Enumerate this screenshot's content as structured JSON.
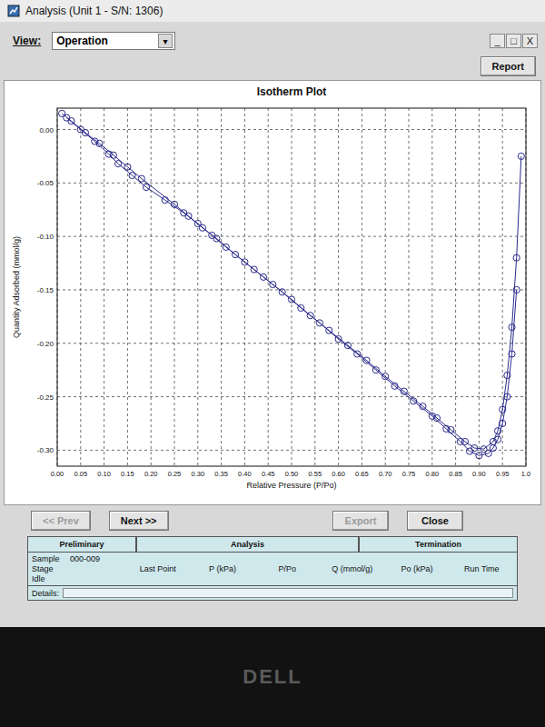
{
  "window": {
    "title": "Analysis (Unit 1 - S/N: 1306)",
    "controls": [
      "_",
      "□",
      "X"
    ]
  },
  "view": {
    "label": "View:",
    "value": "Operation",
    "arrow": "▾"
  },
  "report_button": "Report",
  "chart": {
    "title": "Isotherm Plot",
    "y_axis": {
      "label": "Quantity Adsorbed (mmol/g)",
      "ticks": [
        "0.00",
        "-0.05",
        "-0.10",
        "-0.15",
        "-0.20",
        "-0.25",
        "-0.30"
      ]
    },
    "x_axis": {
      "label": "Relative Pressure (P/Po)",
      "ticks": [
        "0.00",
        "0.05",
        "0.10",
        "0.15",
        "0.20",
        "0.25",
        "0.30",
        "0.35",
        "0.40",
        "0.45",
        "0.50",
        "0.55",
        "0.60",
        "0.65",
        "0.70",
        "0.75",
        "0.80",
        "0.85",
        "0.90",
        "0.95",
        "1.0"
      ]
    },
    "series": [
      {
        "p_po": [
          0.01,
          0.03,
          0.06,
          0.09,
          0.12,
          0.15,
          0.18,
          0.25,
          0.28,
          0.31,
          0.34,
          0.38,
          0.42,
          0.46,
          0.5,
          0.54,
          0.58,
          0.62,
          0.66,
          0.7,
          0.74,
          0.78,
          0.81,
          0.84,
          0.87,
          0.89,
          0.91,
          0.93,
          0.94,
          0.95,
          0.96,
          0.97,
          0.98,
          0.99
        ],
        "quantity": [
          0.015,
          0.008,
          -0.003,
          -0.013,
          -0.024,
          -0.035,
          -0.046,
          -0.07,
          -0.081,
          -0.092,
          -0.102,
          -0.117,
          -0.131,
          -0.145,
          -0.159,
          -0.174,
          -0.188,
          -0.202,
          -0.216,
          -0.231,
          -0.245,
          -0.259,
          -0.27,
          -0.281,
          -0.292,
          -0.298,
          -0.299,
          -0.292,
          -0.282,
          -0.262,
          -0.23,
          -0.185,
          -0.12,
          -0.025
        ]
      },
      {
        "p_po": [
          0.02,
          0.05,
          0.08,
          0.11,
          0.13,
          0.16,
          0.19,
          0.23,
          0.27,
          0.3,
          0.33,
          0.36,
          0.4,
          0.44,
          0.48,
          0.52,
          0.56,
          0.6,
          0.64,
          0.68,
          0.72,
          0.76,
          0.8,
          0.83,
          0.86,
          0.88,
          0.9,
          0.92,
          0.93,
          0.94,
          0.95,
          0.96,
          0.97,
          0.98
        ],
        "quantity": [
          0.011,
          0.0,
          -0.011,
          -0.023,
          -0.032,
          -0.043,
          -0.054,
          -0.066,
          -0.078,
          -0.088,
          -0.099,
          -0.11,
          -0.124,
          -0.138,
          -0.152,
          -0.167,
          -0.181,
          -0.196,
          -0.21,
          -0.225,
          -0.24,
          -0.254,
          -0.268,
          -0.28,
          -0.292,
          -0.301,
          -0.305,
          -0.303,
          -0.298,
          -0.29,
          -0.275,
          -0.25,
          -0.21,
          -0.15
        ]
      }
    ]
  },
  "nav_buttons": [
    {
      "label": "<< Prev",
      "disabled": true
    },
    {
      "label": "Next >>",
      "disabled": false
    },
    {
      "label": "Export",
      "disabled": true
    },
    {
      "label": "Close",
      "disabled": false
    }
  ],
  "status": {
    "sections": [
      "Preliminary",
      "Analysis",
      "Termination"
    ],
    "sample_label": "Sample",
    "sample": "000-009",
    "stage_label": "Stage",
    "stage": "Idle",
    "columns": [
      "Last Point",
      "P (kPa)",
      "P/Po",
      "Q (mmol/g)",
      "Po (kPa)",
      "Run Time"
    ],
    "details_label": "Details:"
  },
  "bezel": {
    "brand": "DELL"
  }
}
